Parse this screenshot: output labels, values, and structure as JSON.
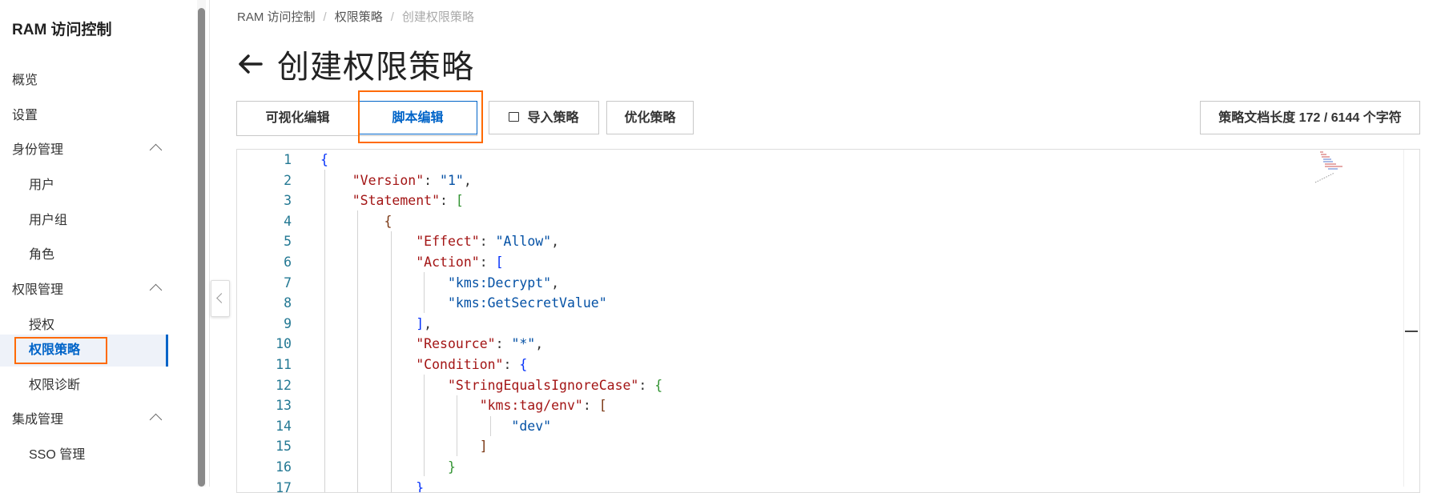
{
  "sidebar": {
    "title": "RAM 访问控制",
    "items": [
      {
        "label": "概览"
      },
      {
        "label": "设置"
      },
      {
        "label": "身份管理"
      },
      {
        "label": "用户"
      },
      {
        "label": "用户组"
      },
      {
        "label": "角色"
      },
      {
        "label": "权限管理"
      },
      {
        "label": "授权"
      },
      {
        "label": "权限策略"
      },
      {
        "label": "权限诊断"
      },
      {
        "label": "集成管理"
      },
      {
        "label": "SSO 管理"
      }
    ]
  },
  "breadcrumb": [
    "RAM 访问控制",
    "权限策略",
    "创建权限策略"
  ],
  "page": {
    "title": "创建权限策略"
  },
  "tabs": [
    "可视化编辑",
    "脚本编辑"
  ],
  "buttons": {
    "import": "导入策略",
    "optimize": "优化策略"
  },
  "doc_length": "策略文档长度 172 / 6144 个字符",
  "editor": {
    "line_numbers": [
      "1",
      "2",
      "3",
      "4",
      "5",
      "6",
      "7",
      "8",
      "9",
      "10",
      "11",
      "12",
      "13",
      "14",
      "15",
      "16",
      "17"
    ],
    "code": {
      "version_key": "\"Version\"",
      "version_val": "\"1\"",
      "statement_key": "\"Statement\"",
      "effect_key": "\"Effect\"",
      "effect_val": "\"Allow\"",
      "action_key": "\"Action\"",
      "action_1": "\"kms:Decrypt\"",
      "action_2": "\"kms:GetSecretValue\"",
      "resource_key": "\"Resource\"",
      "resource_val": "\"*\"",
      "condition_key": "\"Condition\"",
      "sei_key": "\"StringEqualsIgnoreCase\"",
      "tag_key": "\"kms:tag/env\"",
      "tag_val": "\"dev\""
    }
  }
}
